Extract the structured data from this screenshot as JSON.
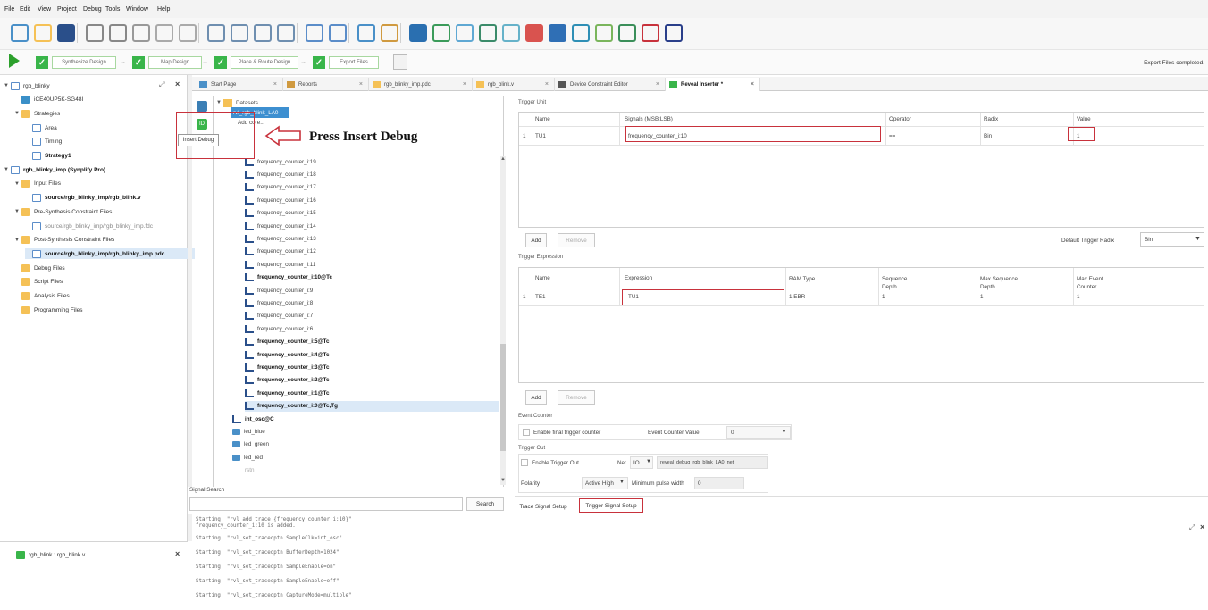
{
  "menu": [
    "File",
    "Edit",
    "View",
    "Project",
    "Debug",
    "Tools",
    "Window",
    "Help"
  ],
  "toolbar_icons": [
    "new-file-icon",
    "open-folder-icon",
    "save-icon",
    "undo-icon",
    "redo-icon",
    "cut-icon",
    "copy-icon",
    "paste-icon",
    "zoom-in-icon",
    "zoom-out-icon",
    "zoom-fit-icon",
    "zoom-area-icon",
    "properties-icon",
    "ip-icon",
    "home-icon",
    "report-icon",
    "tool-run-icon",
    "netlist-icon",
    "spreadsheet-icon",
    "floorplan-icon",
    "timing-icon",
    "power-icon",
    "reveal-icon",
    "programmer-icon",
    "synplify-icon",
    "sim-icon",
    "signal-icon",
    "modelsim-icon"
  ],
  "flow": {
    "steps": [
      "Synthesize Design",
      "Map Design",
      "Place & Route Design",
      "Export Files"
    ],
    "status": "Export Files completed."
  },
  "file_tree": {
    "items": [
      {
        "label": "rgb_blinky",
        "level": 0,
        "icon": "project",
        "caret": "▼"
      },
      {
        "label": "iCE40UP5K-SG48I",
        "level": 1,
        "icon": "chip",
        "caret": ""
      },
      {
        "label": "Strategies",
        "level": 1,
        "icon": "folder",
        "caret": "▼"
      },
      {
        "label": "Area",
        "level": 2,
        "icon": "file",
        "caret": ""
      },
      {
        "label": "Timing",
        "level": 2,
        "icon": "file",
        "caret": ""
      },
      {
        "label": "Strategy1",
        "level": 2,
        "icon": "file",
        "caret": "",
        "bold": true
      },
      {
        "label": "rgb_blinky_imp (Synplify Pro)",
        "level": 0,
        "icon": "project",
        "caret": "▼",
        "bold": true
      },
      {
        "label": "Input Files",
        "level": 1,
        "icon": "folder",
        "caret": "▼"
      },
      {
        "label": "source/rgb_blinky_imp/rgb_blink.v",
        "level": 2,
        "icon": "file",
        "caret": "",
        "bold": true
      },
      {
        "label": "Pre-Synthesis Constraint Files",
        "level": 1,
        "icon": "folder",
        "caret": "▼"
      },
      {
        "label": "source/rgb_blinky_imp/rgb_blinky_imp.fdc",
        "level": 2,
        "icon": "file",
        "caret": "",
        "gray": true
      },
      {
        "label": "Post-Synthesis Constraint Files",
        "level": 1,
        "icon": "folder",
        "caret": "▼"
      },
      {
        "label": "source/rgb_blinky_imp/rgb_blinky_imp.pdc",
        "level": 2,
        "icon": "file",
        "caret": "",
        "bold": true
      },
      {
        "label": "Debug Files",
        "level": 1,
        "icon": "folder",
        "caret": ""
      },
      {
        "label": "Script Files",
        "level": 1,
        "icon": "folder",
        "caret": ""
      },
      {
        "label": "Analysis Files",
        "level": 1,
        "icon": "folder",
        "caret": ""
      },
      {
        "label": "Programming Files",
        "level": 1,
        "icon": "folder",
        "caret": ""
      }
    ],
    "bottom_item": "rgb_blink : rgb_blink.v"
  },
  "tabs": [
    {
      "label": "Start Page",
      "active": false
    },
    {
      "label": "Reports",
      "active": false
    },
    {
      "label": "rgb_blinky_imp.pdc",
      "active": false
    },
    {
      "label": "rgb_blink.v",
      "active": false
    },
    {
      "label": "Device Constraint Editor",
      "active": false
    },
    {
      "label": "Reveal Inserter *",
      "active": true
    }
  ],
  "signals": {
    "datasets_label": "Datasets",
    "selected_dataset": "rvl_rgb_blink_LA0",
    "add_core": "Add core...",
    "items": [
      {
        "label": "frequency_counter_i:19",
        "bold": false
      },
      {
        "label": "frequency_counter_i:18",
        "bold": false
      },
      {
        "label": "frequency_counter_i:17",
        "bold": false
      },
      {
        "label": "frequency_counter_i:16",
        "bold": false
      },
      {
        "label": "frequency_counter_i:15",
        "bold": false
      },
      {
        "label": "frequency_counter_i:14",
        "bold": false
      },
      {
        "label": "frequency_counter_i:13",
        "bold": false
      },
      {
        "label": "frequency_counter_i:12",
        "bold": false
      },
      {
        "label": "frequency_counter_i:11",
        "bold": false
      },
      {
        "label": "frequency_counter_i:10@Tc",
        "bold": true
      },
      {
        "label": "frequency_counter_i:9",
        "bold": false
      },
      {
        "label": "frequency_counter_i:8",
        "bold": false
      },
      {
        "label": "frequency_counter_i:7",
        "bold": false
      },
      {
        "label": "frequency_counter_i:6",
        "bold": false
      },
      {
        "label": "frequency_counter_i:5@Tc",
        "bold": true
      },
      {
        "label": "frequency_counter_i:4@Tc",
        "bold": true
      },
      {
        "label": "frequency_counter_i:3@Tc",
        "bold": true
      },
      {
        "label": "frequency_counter_i:2@Tc",
        "bold": true
      },
      {
        "label": "frequency_counter_i:1@Tc",
        "bold": true
      },
      {
        "label": "frequency_counter_i:0@Tc,Tg",
        "bold": true
      }
    ],
    "other": [
      {
        "label": "int_osc@C",
        "bold": true,
        "type": "wave"
      },
      {
        "label": "led_blue",
        "bold": false,
        "type": "port"
      },
      {
        "label": "led_green",
        "bold": false,
        "type": "port"
      },
      {
        "label": "led_red",
        "bold": false,
        "type": "port"
      },
      {
        "label": "rstn",
        "bold": false,
        "type": "none"
      }
    ],
    "search_label": "Signal Search",
    "search_button": "Search",
    "tooltip": "Insert Debug"
  },
  "trigger_unit": {
    "section": "Trigger Unit",
    "headers": [
      "Name",
      "Signals (MSB:LSB)",
      "Operator",
      "Radix",
      "Value"
    ],
    "row": {
      "index": "1",
      "name": "TU1",
      "signals": "frequency_counter_i:10",
      "operator": "==",
      "radix": "Bin",
      "value": "1"
    },
    "add": "Add",
    "remove": "Remove",
    "default_radix_label": "Default Trigger Radix",
    "default_radix_value": "Bin"
  },
  "trigger_expression": {
    "section": "Trigger Expression",
    "headers": [
      "Name",
      "Expression",
      "RAM Type",
      "Sequence Depth",
      "Max Sequence Depth",
      "Max Event Counter"
    ],
    "row": {
      "index": "1",
      "name": "TE1",
      "expression": "TU1",
      "ram": "1 EBR",
      "seq": "1",
      "maxseq": "1",
      "maxevent": "1"
    },
    "add": "Add",
    "remove": "Remove"
  },
  "event_counter": {
    "section": "Event Counter",
    "enable_label": "Enable final trigger counter",
    "value_label": "Event Counter Value",
    "value": "0"
  },
  "trigger_out": {
    "section": "Trigger Out",
    "enable_label": "Enable Trigger Out",
    "net_label": "Net",
    "net_type": "IO",
    "net_name": "reveal_debug_rgb_blink_LA0_net",
    "polarity_label": "Polarity",
    "polarity_value": "Active High",
    "min_pulse_label": "Minimum pulse width",
    "min_pulse_value": "0"
  },
  "bottom_tabs": [
    "Trace Signal Setup",
    "Trigger Signal Setup"
  ],
  "annotation": "Press Insert Debug",
  "console_lines": [
    "Starting: \"rvl_add_trace  {frequency_counter_i:10}\"",
    "frequency_counter_i:10 is added.",
    "Starting: \"rvl_set_traceoptn SampleClk=int_osc\"",
    "Starting: \"rvl_set_traceoptn BufferDepth=1024\"",
    "Starting: \"rvl_set_traceoptn SampleEnable=on\"",
    "Starting: \"rvl_set_traceoptn SampleEnable=off\"",
    "Starting: \"rvl_set_traceoptn CaptureMode=multiple\""
  ],
  "colors": {
    "accent_red": "#c8323c",
    "flow_green": "#39b54a",
    "selection": "#3d8fd0"
  }
}
